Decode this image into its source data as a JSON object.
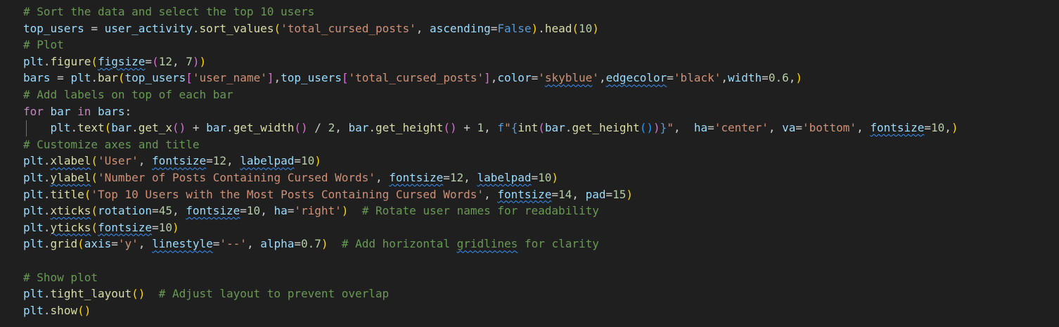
{
  "theme": {
    "background": "#1f1f1f",
    "comment": "#6a9955",
    "variable": "#9cdcfe",
    "function": "#dcdcaa",
    "keyword": "#c586c0",
    "constant": "#569cd6",
    "number": "#b5cea8",
    "string": "#ce9178",
    "bracket_level_1": "#ffd700",
    "bracket_level_2": "#da70d6",
    "bracket_level_3": "#179fff",
    "squiggle": "#3794ff"
  },
  "editor": {
    "lines": [
      [
        {
          "t": "comment",
          "v": "# Sort the data and select the top 10 users"
        }
      ],
      [
        {
          "t": "var",
          "v": "top_users"
        },
        {
          "t": "plain",
          "v": " = "
        },
        {
          "t": "var",
          "v": "user_activity"
        },
        {
          "t": "plain",
          "v": "."
        },
        {
          "t": "func",
          "v": "sort_values"
        },
        {
          "t": "b1",
          "v": "("
        },
        {
          "t": "str",
          "v": "'total_cursed_posts'"
        },
        {
          "t": "plain",
          "v": ", "
        },
        {
          "t": "var",
          "v": "ascending"
        },
        {
          "t": "plain",
          "v": "="
        },
        {
          "t": "const",
          "v": "False"
        },
        {
          "t": "b1",
          "v": ")"
        },
        {
          "t": "plain",
          "v": "."
        },
        {
          "t": "func",
          "v": "head"
        },
        {
          "t": "b1",
          "v": "("
        },
        {
          "t": "num",
          "v": "10"
        },
        {
          "t": "b1",
          "v": ")"
        }
      ],
      [
        {
          "t": "comment",
          "v": "# Plot"
        }
      ],
      [
        {
          "t": "var",
          "v": "plt"
        },
        {
          "t": "plain",
          "v": "."
        },
        {
          "t": "func",
          "v": "figure"
        },
        {
          "t": "b1",
          "v": "("
        },
        {
          "t": "var",
          "v": "figsize",
          "sq": true
        },
        {
          "t": "plain",
          "v": "="
        },
        {
          "t": "b2",
          "v": "("
        },
        {
          "t": "num",
          "v": "12"
        },
        {
          "t": "plain",
          "v": ", "
        },
        {
          "t": "num",
          "v": "7"
        },
        {
          "t": "b2",
          "v": ")"
        },
        {
          "t": "b1",
          "v": ")"
        }
      ],
      [
        {
          "t": "var",
          "v": "bars"
        },
        {
          "t": "plain",
          "v": " = "
        },
        {
          "t": "var",
          "v": "plt"
        },
        {
          "t": "plain",
          "v": "."
        },
        {
          "t": "func",
          "v": "bar"
        },
        {
          "t": "b1",
          "v": "("
        },
        {
          "t": "var",
          "v": "top_users"
        },
        {
          "t": "b2",
          "v": "["
        },
        {
          "t": "str",
          "v": "'user_name'"
        },
        {
          "t": "b2",
          "v": "]"
        },
        {
          "t": "plain",
          "v": ","
        },
        {
          "t": "var",
          "v": "top_users"
        },
        {
          "t": "b2",
          "v": "["
        },
        {
          "t": "str",
          "v": "'total_cursed_posts'"
        },
        {
          "t": "b2",
          "v": "]"
        },
        {
          "t": "plain",
          "v": ","
        },
        {
          "t": "var",
          "v": "color"
        },
        {
          "t": "plain",
          "v": "="
        },
        {
          "t": "str",
          "v": "'"
        },
        {
          "t": "str",
          "v": "skyblue",
          "sq": true
        },
        {
          "t": "str",
          "v": "'"
        },
        {
          "t": "plain",
          "v": ","
        },
        {
          "t": "var",
          "v": "edgecolor",
          "sq": true
        },
        {
          "t": "plain",
          "v": "="
        },
        {
          "t": "str",
          "v": "'black'"
        },
        {
          "t": "plain",
          "v": ","
        },
        {
          "t": "var",
          "v": "width"
        },
        {
          "t": "plain",
          "v": "="
        },
        {
          "t": "num",
          "v": "0.6"
        },
        {
          "t": "plain",
          "v": ","
        },
        {
          "t": "b1",
          "v": ")"
        }
      ],
      [
        {
          "t": "comment",
          "v": "# Add labels on top of each bar"
        }
      ],
      [
        {
          "t": "keyword",
          "v": "for"
        },
        {
          "t": "plain",
          "v": " "
        },
        {
          "t": "var",
          "v": "bar"
        },
        {
          "t": "plain",
          "v": " "
        },
        {
          "t": "keyword",
          "v": "in"
        },
        {
          "t": "plain",
          "v": " "
        },
        {
          "t": "var",
          "v": "bars"
        },
        {
          "t": "plain",
          "v": ":"
        }
      ],
      [
        {
          "t": "plain",
          "v": "    "
        },
        {
          "t": "var",
          "v": "plt"
        },
        {
          "t": "plain",
          "v": "."
        },
        {
          "t": "func",
          "v": "text"
        },
        {
          "t": "b1",
          "v": "("
        },
        {
          "t": "var",
          "v": "bar"
        },
        {
          "t": "plain",
          "v": "."
        },
        {
          "t": "func",
          "v": "get_x"
        },
        {
          "t": "b2",
          "v": "()"
        },
        {
          "t": "plain",
          "v": " + "
        },
        {
          "t": "var",
          "v": "bar"
        },
        {
          "t": "plain",
          "v": "."
        },
        {
          "t": "func",
          "v": "get_width"
        },
        {
          "t": "b2",
          "v": "()"
        },
        {
          "t": "plain",
          "v": " / "
        },
        {
          "t": "num",
          "v": "2"
        },
        {
          "t": "plain",
          "v": ", "
        },
        {
          "t": "var",
          "v": "bar"
        },
        {
          "t": "plain",
          "v": "."
        },
        {
          "t": "func",
          "v": "get_height"
        },
        {
          "t": "b2",
          "v": "()"
        },
        {
          "t": "plain",
          "v": " + "
        },
        {
          "t": "num",
          "v": "1"
        },
        {
          "t": "plain",
          "v": ", "
        },
        {
          "t": "const",
          "v": "f"
        },
        {
          "t": "str",
          "v": "\""
        },
        {
          "t": "const",
          "v": "{"
        },
        {
          "t": "func",
          "v": "int"
        },
        {
          "t": "b2",
          "v": "("
        },
        {
          "t": "var",
          "v": "bar"
        },
        {
          "t": "plain",
          "v": "."
        },
        {
          "t": "func",
          "v": "get_height"
        },
        {
          "t": "b3",
          "v": "()"
        },
        {
          "t": "b2",
          "v": ")"
        },
        {
          "t": "const",
          "v": "}"
        },
        {
          "t": "str",
          "v": "\""
        },
        {
          "t": "plain",
          "v": ",  "
        },
        {
          "t": "var",
          "v": "ha"
        },
        {
          "t": "plain",
          "v": "="
        },
        {
          "t": "str",
          "v": "'center'"
        },
        {
          "t": "plain",
          "v": ", "
        },
        {
          "t": "var",
          "v": "va"
        },
        {
          "t": "plain",
          "v": "="
        },
        {
          "t": "str",
          "v": "'bottom'"
        },
        {
          "t": "plain",
          "v": ", "
        },
        {
          "t": "var",
          "v": "fontsize",
          "sq": true
        },
        {
          "t": "plain",
          "v": "="
        },
        {
          "t": "num",
          "v": "10"
        },
        {
          "t": "plain",
          "v": ","
        },
        {
          "t": "b1",
          "v": ")"
        }
      ],
      [
        {
          "t": "comment",
          "v": "# Customize axes and title"
        }
      ],
      [
        {
          "t": "var",
          "v": "plt"
        },
        {
          "t": "plain",
          "v": "."
        },
        {
          "t": "func",
          "v": "xlabel",
          "sq": true
        },
        {
          "t": "b1",
          "v": "("
        },
        {
          "t": "str",
          "v": "'User'"
        },
        {
          "t": "plain",
          "v": ", "
        },
        {
          "t": "var",
          "v": "fontsize",
          "sq": true
        },
        {
          "t": "plain",
          "v": "="
        },
        {
          "t": "num",
          "v": "12"
        },
        {
          "t": "plain",
          "v": ", "
        },
        {
          "t": "var",
          "v": "labelpad",
          "sq": true
        },
        {
          "t": "plain",
          "v": "="
        },
        {
          "t": "num",
          "v": "10"
        },
        {
          "t": "b1",
          "v": ")"
        }
      ],
      [
        {
          "t": "var",
          "v": "plt"
        },
        {
          "t": "plain",
          "v": "."
        },
        {
          "t": "func",
          "v": "ylabel",
          "sq": true
        },
        {
          "t": "b1",
          "v": "("
        },
        {
          "t": "str",
          "v": "'Number of Posts Containing Cursed Words'"
        },
        {
          "t": "plain",
          "v": ", "
        },
        {
          "t": "var",
          "v": "fontsize",
          "sq": true
        },
        {
          "t": "plain",
          "v": "="
        },
        {
          "t": "num",
          "v": "12"
        },
        {
          "t": "plain",
          "v": ", "
        },
        {
          "t": "var",
          "v": "labelpad",
          "sq": true
        },
        {
          "t": "plain",
          "v": "="
        },
        {
          "t": "num",
          "v": "10"
        },
        {
          "t": "b1",
          "v": ")"
        }
      ],
      [
        {
          "t": "var",
          "v": "plt"
        },
        {
          "t": "plain",
          "v": "."
        },
        {
          "t": "func",
          "v": "title"
        },
        {
          "t": "b1",
          "v": "("
        },
        {
          "t": "str",
          "v": "'Top 10 Users with the Most Posts Containing Cursed Words'"
        },
        {
          "t": "plain",
          "v": ", "
        },
        {
          "t": "var",
          "v": "fontsize",
          "sq": true
        },
        {
          "t": "plain",
          "v": "="
        },
        {
          "t": "num",
          "v": "14"
        },
        {
          "t": "plain",
          "v": ", "
        },
        {
          "t": "var",
          "v": "pad"
        },
        {
          "t": "plain",
          "v": "="
        },
        {
          "t": "num",
          "v": "15"
        },
        {
          "t": "b1",
          "v": ")"
        }
      ],
      [
        {
          "t": "var",
          "v": "plt"
        },
        {
          "t": "plain",
          "v": "."
        },
        {
          "t": "func",
          "v": "xticks",
          "sq": true
        },
        {
          "t": "b1",
          "v": "("
        },
        {
          "t": "var",
          "v": "rotation"
        },
        {
          "t": "plain",
          "v": "="
        },
        {
          "t": "num",
          "v": "45"
        },
        {
          "t": "plain",
          "v": ", "
        },
        {
          "t": "var",
          "v": "fontsize",
          "sq": true
        },
        {
          "t": "plain",
          "v": "="
        },
        {
          "t": "num",
          "v": "10"
        },
        {
          "t": "plain",
          "v": ", "
        },
        {
          "t": "var",
          "v": "ha"
        },
        {
          "t": "plain",
          "v": "="
        },
        {
          "t": "str",
          "v": "'right'"
        },
        {
          "t": "b1",
          "v": ")"
        },
        {
          "t": "plain",
          "v": "  "
        },
        {
          "t": "comment",
          "v": "# Rotate user names for readability"
        }
      ],
      [
        {
          "t": "var",
          "v": "plt"
        },
        {
          "t": "plain",
          "v": "."
        },
        {
          "t": "func",
          "v": "yticks",
          "sq": true
        },
        {
          "t": "b1",
          "v": "("
        },
        {
          "t": "var",
          "v": "fontsize",
          "sq": true
        },
        {
          "t": "plain",
          "v": "="
        },
        {
          "t": "num",
          "v": "10"
        },
        {
          "t": "b1",
          "v": ")"
        }
      ],
      [
        {
          "t": "var",
          "v": "plt"
        },
        {
          "t": "plain",
          "v": "."
        },
        {
          "t": "func",
          "v": "grid"
        },
        {
          "t": "b1",
          "v": "("
        },
        {
          "t": "var",
          "v": "axis"
        },
        {
          "t": "plain",
          "v": "="
        },
        {
          "t": "str",
          "v": "'y'"
        },
        {
          "t": "plain",
          "v": ", "
        },
        {
          "t": "var",
          "v": "linestyle",
          "sq": true
        },
        {
          "t": "plain",
          "v": "="
        },
        {
          "t": "str",
          "v": "'--'"
        },
        {
          "t": "plain",
          "v": ", "
        },
        {
          "t": "var",
          "v": "alpha"
        },
        {
          "t": "plain",
          "v": "="
        },
        {
          "t": "num",
          "v": "0.7"
        },
        {
          "t": "b1",
          "v": ")"
        },
        {
          "t": "plain",
          "v": "  "
        },
        {
          "t": "comment",
          "v": "# Add horizontal "
        },
        {
          "t": "comment",
          "v": "gridlines",
          "sq": true
        },
        {
          "t": "comment",
          "v": " for clarity"
        }
      ],
      [],
      [
        {
          "t": "comment",
          "v": "# Show plot"
        }
      ],
      [
        {
          "t": "var",
          "v": "plt"
        },
        {
          "t": "plain",
          "v": "."
        },
        {
          "t": "func",
          "v": "tight_layout"
        },
        {
          "t": "b1",
          "v": "()"
        },
        {
          "t": "plain",
          "v": "  "
        },
        {
          "t": "comment",
          "v": "# Adjust layout to prevent overlap"
        }
      ],
      [
        {
          "t": "var",
          "v": "plt"
        },
        {
          "t": "plain",
          "v": "."
        },
        {
          "t": "func",
          "v": "show"
        },
        {
          "t": "b1",
          "v": "()"
        }
      ]
    ]
  }
}
